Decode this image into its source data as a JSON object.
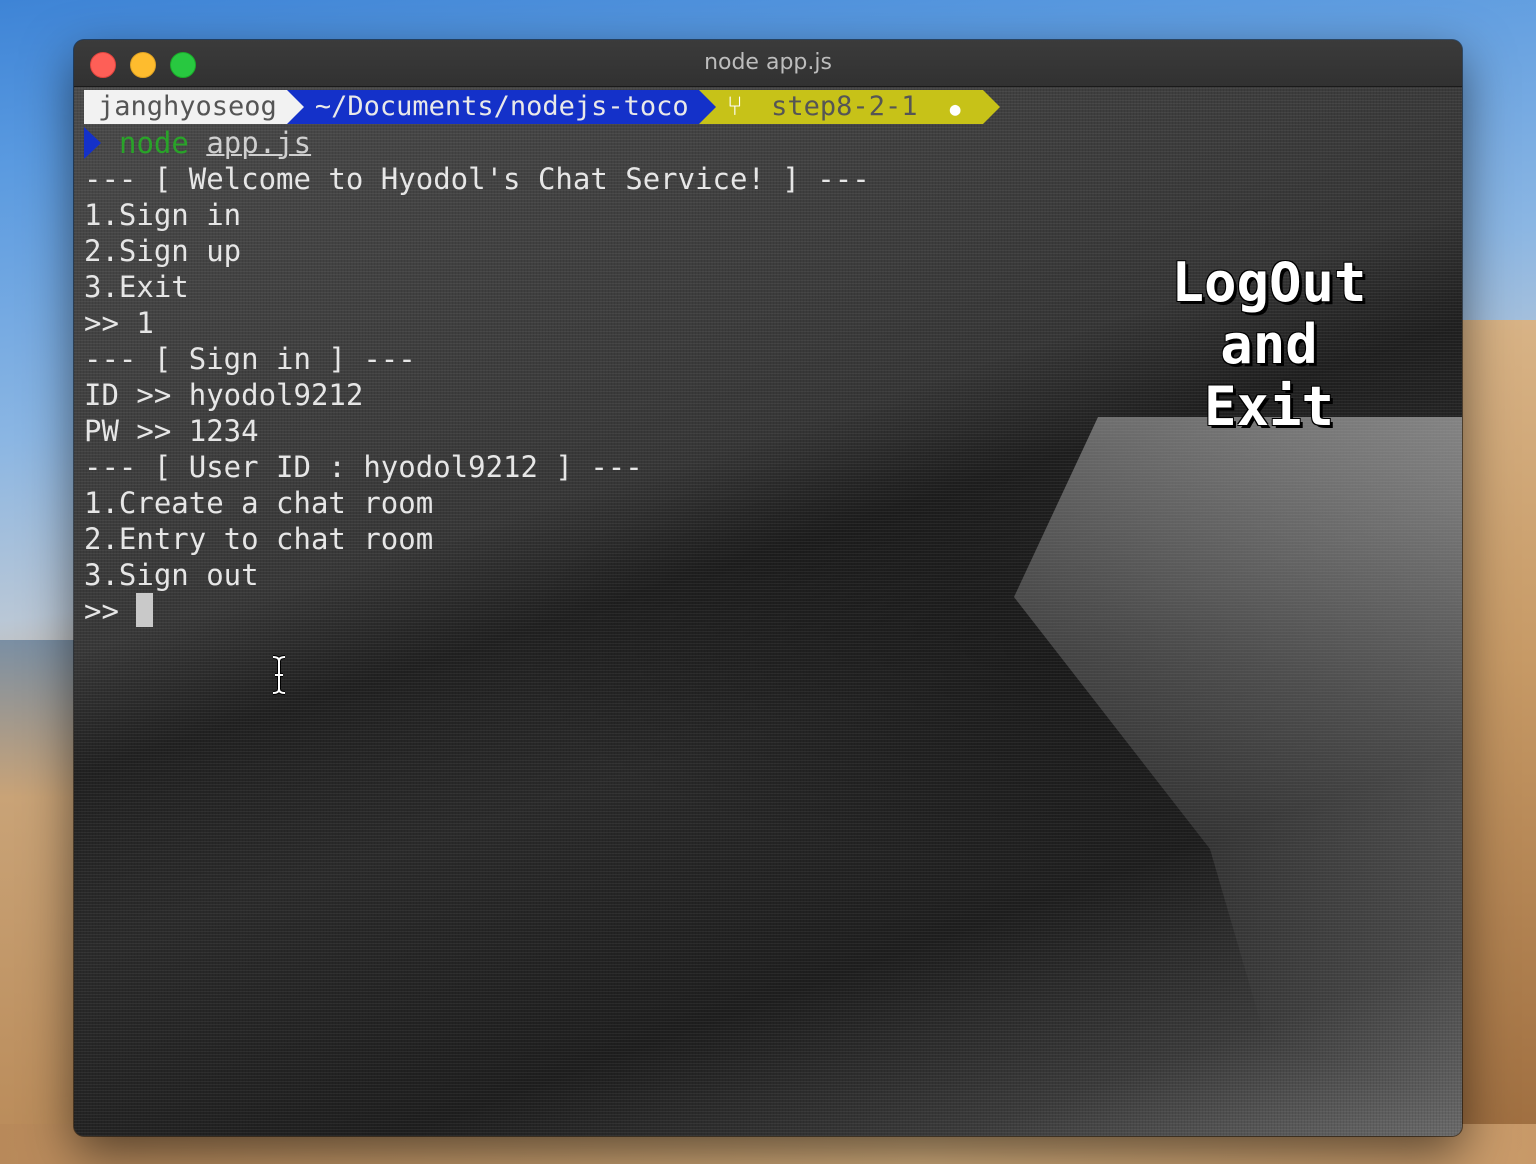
{
  "window": {
    "title": "node app.js"
  },
  "prompt": {
    "user": "janghyoseog",
    "directory": "~/Documents/nodejs-toco",
    "git_branch": "step8-2-1",
    "git_branch_icon": "git-branch-icon",
    "git_dirty_icon": "dot-icon"
  },
  "command": {
    "program": "node",
    "argument": "app.js"
  },
  "output": {
    "lines": [
      "--- [ Welcome to Hyodol's Chat Service! ] ---",
      "1.Sign in",
      "2.Sign up",
      "3.Exit",
      ">> 1",
      "--- [ Sign in ] ---",
      "ID >> hyodol9212",
      "PW >> 1234",
      "--- [ User ID : hyodol9212 ] ---",
      "1.Create a chat room",
      "2.Entry to chat room",
      "3.Sign out"
    ],
    "input_prompt": ">> "
  },
  "overlay": {
    "lines": [
      "LogOut",
      "and",
      "Exit"
    ]
  },
  "colors": {
    "prompt_user_bg": "#f2f2f2",
    "prompt_dir_bg": "#1431c9",
    "prompt_git_bg": "#c7c218",
    "command_green": "#29a329"
  }
}
